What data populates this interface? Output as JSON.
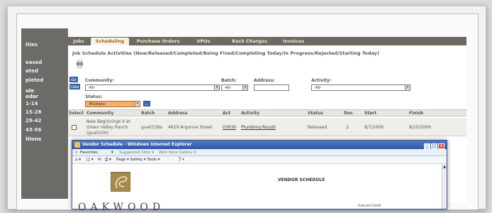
{
  "left_nav": {
    "items": [
      "ities",
      "eased",
      "ated",
      "pleted",
      "ule",
      "edar",
      "1-14",
      "15-28",
      "29-42",
      "43-56",
      "itions"
    ]
  },
  "tabs": [
    "Jobs",
    "Scheduling",
    "Purchase Orders",
    "VPOs",
    "Back Charges",
    "Invoices"
  ],
  "active_tab": "Scheduling",
  "page": {
    "heading": "Job Schedule Activities (New/Released/Completed/Being Fixed/Completing Today/In Progress/Rejected/Starting Today)",
    "go_label": "Go",
    "clear_label": "Clear"
  },
  "filters": {
    "community_label": "Community:",
    "community_value": "-All-",
    "batch_label": "Batch:",
    "batch_value": "-All-",
    "address_label": "Address:",
    "address_value": "",
    "activity_label": "Activity:",
    "activity_value": "-All-",
    "status_label": "Status:",
    "status_value": "-Multiple-",
    "status_button": "..."
  },
  "table": {
    "headers": [
      "Select",
      "Community",
      "Batch",
      "Address",
      "Act",
      "Activity",
      "Status",
      "Dur.",
      "Start",
      "Finish"
    ],
    "rows": [
      {
        "community": [
          "New Beginnings II at",
          "Green Valley Ranch",
          "(gva0100)"
        ],
        "batch": "gva0158a",
        "address": "4629 Argonne Street",
        "act": "03030",
        "activity": "Plumbing Rough",
        "status": "Released",
        "duration": "2",
        "start": "8/7/2009",
        "finish": "8/10/2009"
      }
    ]
  },
  "ie_window": {
    "title": "Vendor Schedule - Windows Internet Explorer",
    "favorites": "Favorites",
    "suggested_sites": "Suggested Sites ▾",
    "web_slice": "Web Slice Gallery ▾",
    "toolbar": "Page ▾   Safety ▾   Tools ▾",
    "report_title": "VENDOR SCHEDULE",
    "logo_text": "OAKWOOD",
    "date_text": "Date:8/7/2009"
  },
  "colors": {
    "tab_bar": "#6d6a63",
    "active_tab_text": "#a9620f",
    "status_select": "#f5b06a",
    "ie_titlebar": "#2d57a3"
  }
}
